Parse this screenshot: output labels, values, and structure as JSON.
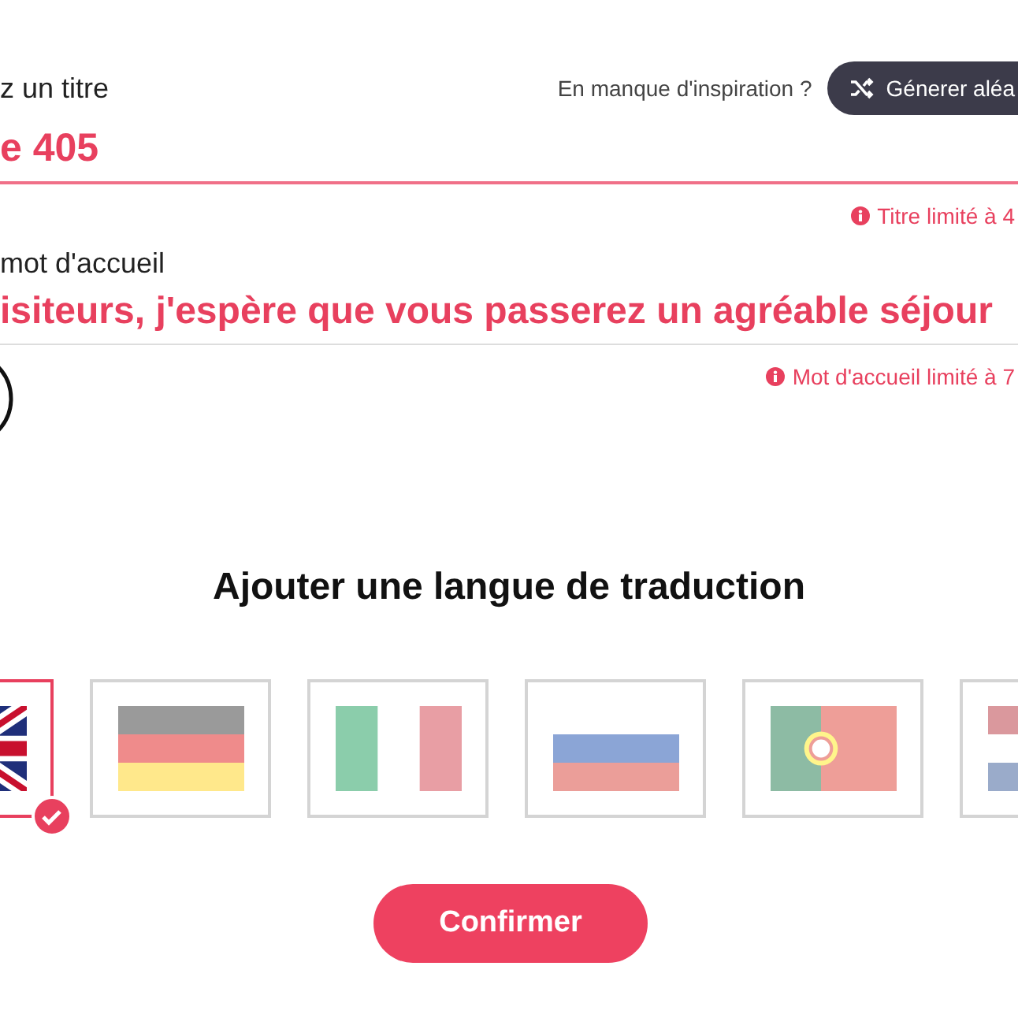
{
  "title_field": {
    "label": "z un titre",
    "value": "e 405",
    "hint": "En manque d'inspiration ?",
    "generate_button": "Génerer aléa",
    "limit_note": "Titre limité à 4"
  },
  "welcome_field": {
    "label": "mot d'accueil",
    "value": "isiteurs, j'espère que vous passerez un agréable séjour",
    "limit_note": "Mot d'accueil limité à 7"
  },
  "translation": {
    "heading": "Ajouter une langue de traduction",
    "flags": [
      {
        "kind": "uk",
        "selected": true
      },
      {
        "kind": "de",
        "selected": false
      },
      {
        "kind": "it",
        "selected": false
      },
      {
        "kind": "ru",
        "selected": false
      },
      {
        "kind": "pt",
        "selected": false
      },
      {
        "kind": "nl",
        "selected": false
      }
    ]
  },
  "confirm_button": "Confirmer"
}
